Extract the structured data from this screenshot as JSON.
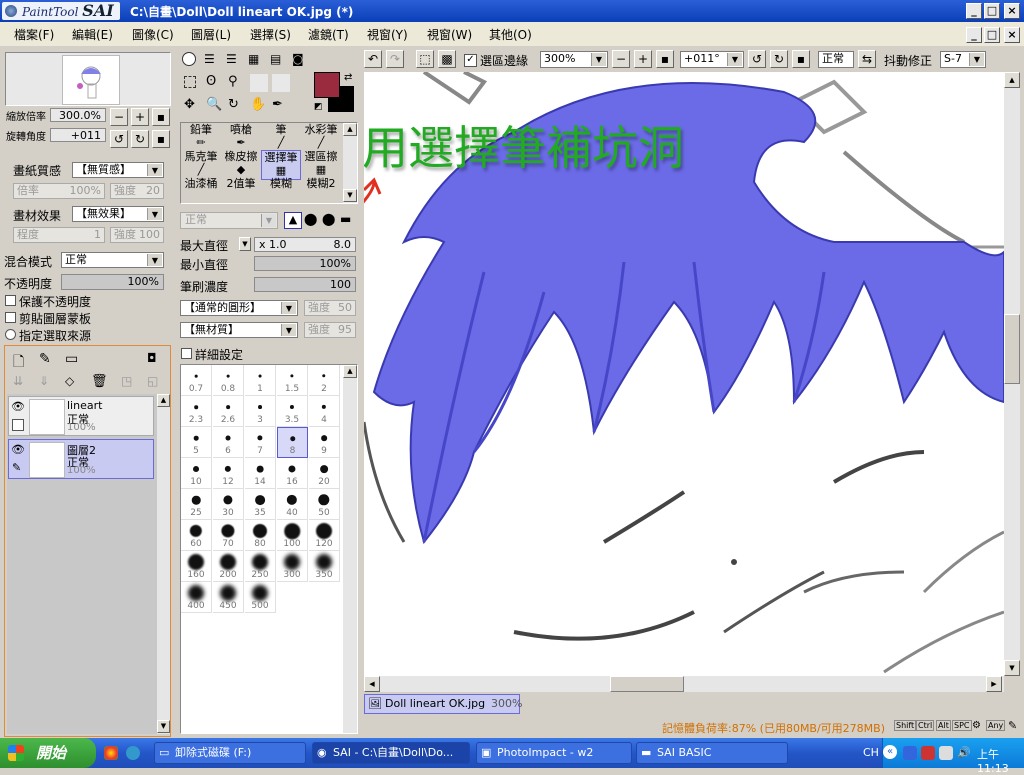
{
  "title": {
    "app_logo": "PaintTool",
    "app_logo_big": "SAI",
    "document": "C:\\自畫\\Doll\\Doll lineart OK.jpg (*)"
  },
  "menu": [
    "檔案(F)",
    "編輯(E)",
    "圖像(C)",
    "圖層(L)",
    "選擇(S)",
    "濾鏡(T)",
    "視窗(Y)",
    "視窗(W)",
    "其他(O)"
  ],
  "navigator": {
    "zoom_label": "縮放倍率",
    "zoom_value": "300.0%",
    "angle_label": "旋轉角度",
    "angle_value": "+011"
  },
  "paper": {
    "texture_label": "畫紙質感",
    "texture_value": "【無質感】",
    "ratio_label": "倍率",
    "ratio_value": "100%",
    "strength_label": "強度",
    "strength_value": "20",
    "effect_label": "畫材效果",
    "effect_value": "【無效果】",
    "degree_label": "程度",
    "degree_value": "1",
    "effect_strength_label": "強度",
    "effect_strength_value": "100"
  },
  "layer_props": {
    "blend_label": "混合模式",
    "blend_value": "正常",
    "opacity_label": "不透明度",
    "opacity_value": "100%",
    "opacity_fraction": 1.0,
    "preserve_opacity": "保護不透明度",
    "clipping": "剪貼圖層蒙板",
    "selection_source": "指定選取來源"
  },
  "layers": [
    {
      "name": "lineart",
      "mode": "正常",
      "opacity": "100%"
    },
    {
      "name": "圖層2",
      "mode": "正常",
      "opacity": "100%"
    }
  ],
  "tools": {
    "row1": [
      "鉛筆",
      "噴槍",
      "筆",
      "水彩筆"
    ],
    "row2": [
      "馬克筆",
      "橡皮擦",
      "選擇筆",
      "選區擦"
    ],
    "row3": [
      "油漆桶",
      "2值筆",
      "模糊",
      "模糊2"
    ],
    "selected": "選擇筆"
  },
  "brush": {
    "mode_value": "正常",
    "max_size_label": "最大直徑",
    "max_size_mult": "x 1.0",
    "max_size_value": "8.0",
    "min_size_label": "最小直徑",
    "min_size_value": "100%",
    "density_label": "筆刷濃度",
    "density_value": "100",
    "shape_value": "【通常的圓形】",
    "shape_strength_label": "強度",
    "shape_strength_value": "50",
    "texture_value": "【無材質】",
    "texture_strength_label": "強度",
    "texture_strength_value": "95",
    "detail_label": "詳細設定",
    "sizes": [
      "0.7",
      "0.8",
      "1",
      "1.5",
      "2",
      "2.3",
      "2.6",
      "3",
      "3.5",
      "4",
      "5",
      "6",
      "7",
      "8",
      "9",
      "10",
      "12",
      "14",
      "16",
      "20",
      "25",
      "30",
      "35",
      "40",
      "50",
      "60",
      "70",
      "80",
      "100",
      "120",
      "160",
      "200",
      "250",
      "300",
      "350",
      "400",
      "450",
      "500"
    ],
    "selected_size": "8"
  },
  "toolbar": {
    "selection_edge_label": "選區邊緣",
    "zoom_value": "300%",
    "angle_value": "+011°",
    "mode_value": "正常",
    "stabilizer_label": "抖動修正",
    "stabilizer_value": "S-7"
  },
  "annotation": {
    "text": "用選擇筆補坑洞"
  },
  "canvas_tab": {
    "filename": "Doll lineart OK.jpg",
    "zoom": "300%"
  },
  "status": {
    "memory": "記憶體負荷率:87% (已用80MB/可用278MB)",
    "keys": [
      "Shift",
      "Ctrl",
      "Alt",
      "SPC",
      "Any"
    ]
  },
  "taskbar": {
    "start": "開始",
    "tasks": [
      "卸除式磁碟 (F:)",
      "SAI - C:\\自畫\\Doll\\Do...",
      "PhotoImpact - w2",
      "SAI BASIC"
    ],
    "lang": "CH",
    "clock": "上午 11:13"
  },
  "colors": {
    "primary": "#9a2a3e",
    "secondary": "#000000",
    "hair": "#6b6be8",
    "annotation": "#22aa22",
    "arrow": "#e03020"
  }
}
